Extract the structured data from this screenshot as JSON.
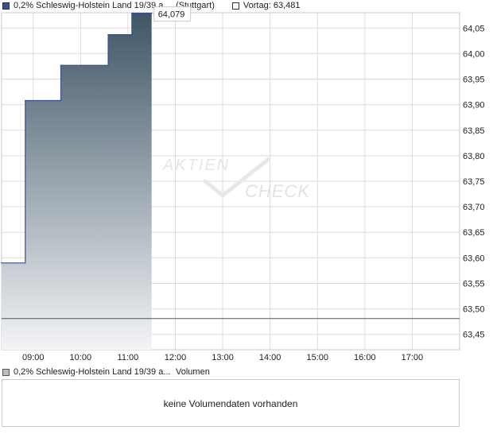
{
  "legend": {
    "instrument": "0,2% Schleswig-Holstein Land 19/39 a...",
    "exchange": "(Stuttgart)",
    "previous_close_label": "Vortag: 63,481",
    "series_color": "#3a4f8c"
  },
  "volume": {
    "legend_instrument": "0,2% Schleswig-Holstein Land 19/39 a...",
    "legend_label": "Volumen",
    "message": "keine Volumendaten vorhanden"
  },
  "watermark": {
    "line1": "AKTIEN",
    "line2": "CHECK"
  },
  "chart_data": {
    "type": "area",
    "x_labels": [
      "09:00",
      "10:00",
      "11:00",
      "12:00",
      "13:00",
      "14:00",
      "15:00",
      "16:00",
      "17:00"
    ],
    "y_labels": [
      "64,05",
      "64,00",
      "63,95",
      "63,90",
      "63,85",
      "63,80",
      "63,75",
      "63,70",
      "63,65",
      "63,60",
      "63,55",
      "63,50",
      "63,45"
    ],
    "ylim": [
      63.42,
      64.08
    ],
    "xlim": [
      "08:20",
      "18:00"
    ],
    "grid": true,
    "series": [
      {
        "name": "0,2% Schleswig-Holstein Land 19/39 a...",
        "step": true,
        "points": [
          {
            "time": "08:20",
            "value": 63.59
          },
          {
            "time": "08:50",
            "value": 63.908
          },
          {
            "time": "09:35",
            "value": 63.977
          },
          {
            "time": "10:35",
            "value": 64.037
          },
          {
            "time": "11:05",
            "value": 64.079
          },
          {
            "time": "11:30",
            "value": 64.079
          }
        ]
      }
    ],
    "previous_close": 63.481,
    "last_value_label": "64,079"
  }
}
